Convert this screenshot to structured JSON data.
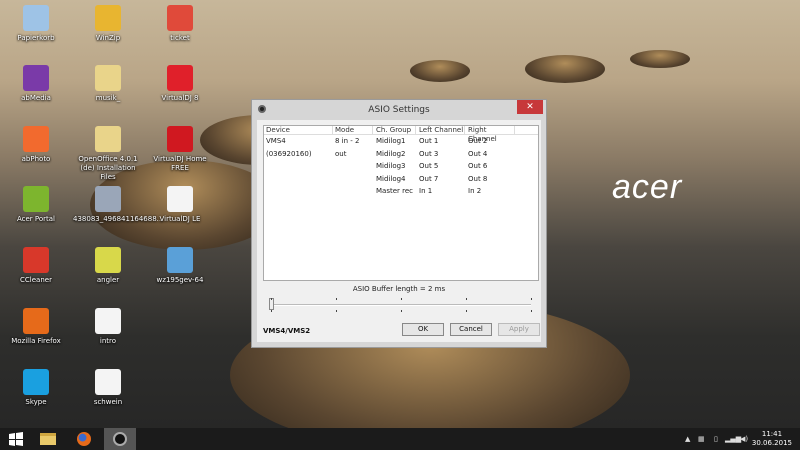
{
  "desktop": {
    "brand": "acer",
    "icons": [
      {
        "label": "Papierkorb",
        "icon": "recycle-bin-icon",
        "color": "#9ec3e6"
      },
      {
        "label": "WinZip",
        "icon": "winzip-icon",
        "color": "#e8b530"
      },
      {
        "label": "ticket",
        "icon": "pdf-file-icon",
        "color": "#e04a3a"
      },
      {
        "label": "abMedia",
        "icon": "abmedia-icon",
        "color": "#7a3aa8"
      },
      {
        "label": "musik_",
        "icon": "folder-icon",
        "color": "#e9d48a"
      },
      {
        "label": "VirtualDJ 8",
        "icon": "virtualdj-icon",
        "color": "#e0202a"
      },
      {
        "label": "abPhoto",
        "icon": "abphoto-icon",
        "color": "#f26a2e"
      },
      {
        "label": "OpenOffice 4.0.1 (de) Installation Files",
        "icon": "folder-icon",
        "color": "#e9d48a"
      },
      {
        "label": "VirtualDJ Home FREE",
        "icon": "virtualdj-home-icon",
        "color": "#d01820"
      },
      {
        "label": "Acer Portal",
        "icon": "acer-portal-icon",
        "color": "#7db52e"
      },
      {
        "label": "438083_496841164688...",
        "icon": "image-file-icon",
        "color": "#9aa6b8"
      },
      {
        "label": "VirtualDJ LE",
        "icon": "file-icon",
        "color": "#f4f4f4"
      },
      {
        "label": "CCleaner",
        "icon": "ccleaner-icon",
        "color": "#d8382a"
      },
      {
        "label": "angler",
        "icon": "image-file-icon",
        "color": "#d8d84a"
      },
      {
        "label": "wz195gev-64",
        "icon": "installer-icon",
        "color": "#5aa0d8"
      },
      {
        "label": "Mozilla Firefox",
        "icon": "firefox-icon",
        "color": "#e66a1a"
      },
      {
        "label": "intro",
        "icon": "mp3-file-icon",
        "color": "#f4f4f4"
      },
      {
        "label": "Skype",
        "icon": "skype-icon",
        "color": "#1aa0e0"
      },
      {
        "label": "schwein",
        "icon": "mp3-file-icon",
        "color": "#f4f4f4"
      }
    ]
  },
  "dialog": {
    "title": "ASIO Settings",
    "close": "✕",
    "columns": [
      "Device",
      "Mode",
      "Ch. Group",
      "Left Channel",
      "Right Channel"
    ],
    "rows": [
      [
        "VMS4 (036920160)",
        "8 in - 2 out",
        "Midilog1",
        "Out 1",
        "Out 2"
      ],
      [
        "",
        "",
        "Midilog2",
        "Out 3",
        "Out 4"
      ],
      [
        "",
        "",
        "Midilog3",
        "Out 5",
        "Out 6"
      ],
      [
        "",
        "",
        "Midilog4",
        "Out 7",
        "Out 8"
      ],
      [
        "",
        "",
        "Master rec",
        "In 1",
        "In 2"
      ]
    ],
    "buffer_label": "ASIO Buffer length = 2 ms",
    "buffer_position": 0,
    "model": "VMS4/VMS2",
    "ok": "OK",
    "cancel": "Cancel",
    "apply": "Apply"
  },
  "taskbar": {
    "time": "11:41",
    "date": "30.06.2015"
  }
}
